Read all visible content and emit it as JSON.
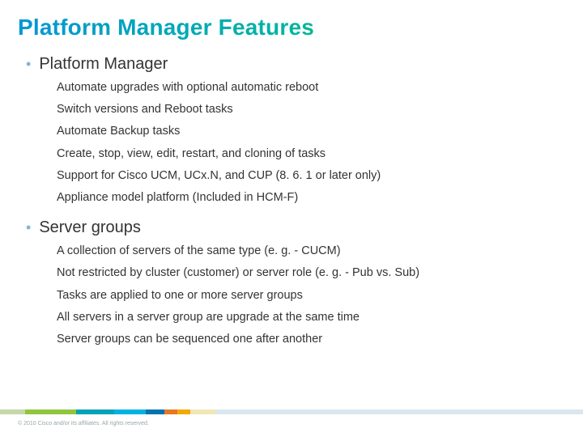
{
  "title": "Platform Manager Features",
  "sections": [
    {
      "label": "Platform Manager",
      "items": [
        "Automate upgrades with optional automatic reboot",
        "Switch versions and Reboot tasks",
        "Automate Backup tasks",
        "Create, stop, view, edit, restart, and cloning of tasks",
        "Support for Cisco UCM, UCx.N, and CUP (8. 6. 1 or later only)",
        "Appliance model platform (Included in HCM-F)"
      ]
    },
    {
      "label": "Server groups",
      "items": [
        "A collection of servers of the same type (e. g. - CUCM)",
        "Not restricted by cluster (customer) or server role (e. g. - Pub vs. Sub)",
        "Tasks are applied to one or more server groups",
        "All servers in a server group are upgrade at the same time",
        "Server groups can be sequenced one after another"
      ]
    }
  ],
  "footer": {
    "copyright": "© 2010 Cisco and/or its affiliates. All rights reserved."
  }
}
